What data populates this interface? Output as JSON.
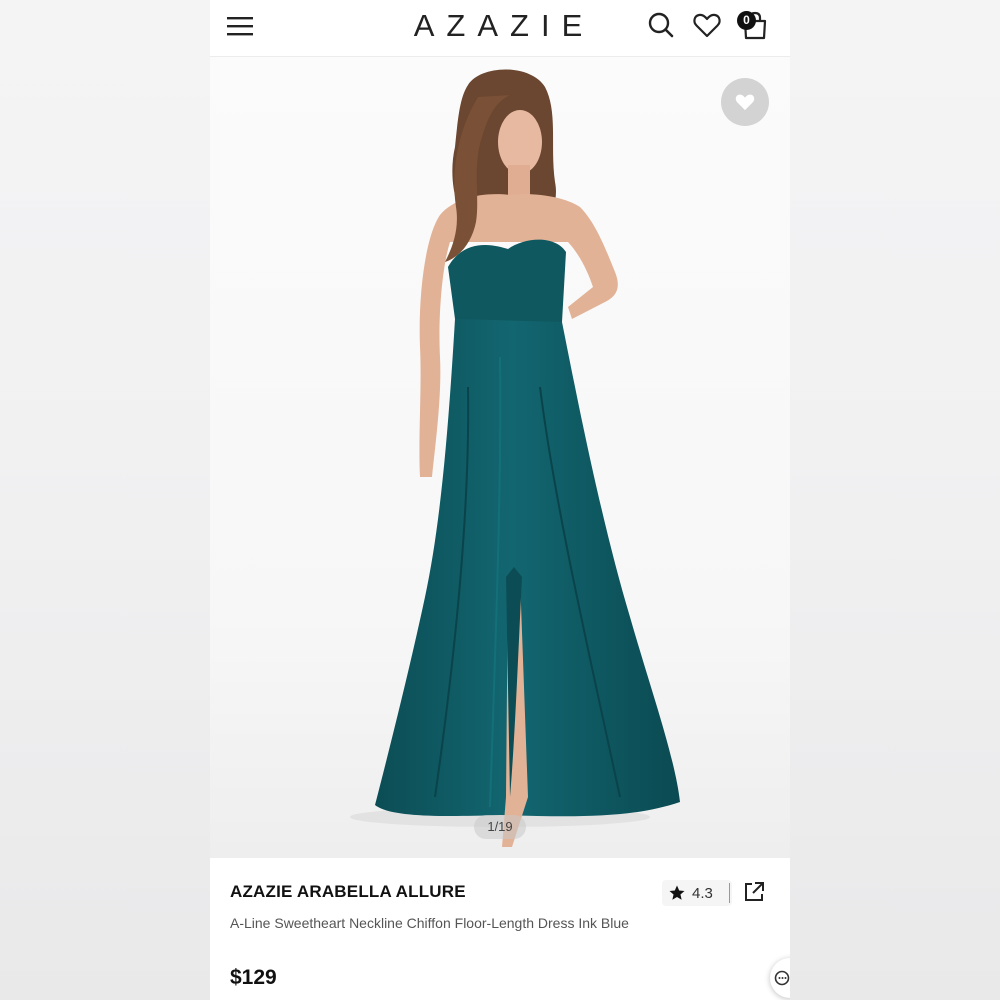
{
  "header": {
    "logo": "AZAZIE",
    "cart_count": "0"
  },
  "icons": {
    "menu": "hamburger-menu-icon",
    "search": "search-icon",
    "wishlist": "heart-icon",
    "cart": "shopping-bag-icon",
    "favorite": "heart-icon",
    "rating_star": "star-icon",
    "share": "share-icon",
    "chat": "chat-icon"
  },
  "gallery": {
    "counter": "1/19",
    "dress_color": "#0f5a63"
  },
  "product": {
    "brand": "AZAZIE ARABELLA ALLURE",
    "description": "A-Line Sweetheart Neckline Chiffon Floor-Length Dress Ink Blue",
    "rating": "4.3",
    "price": "$129"
  }
}
